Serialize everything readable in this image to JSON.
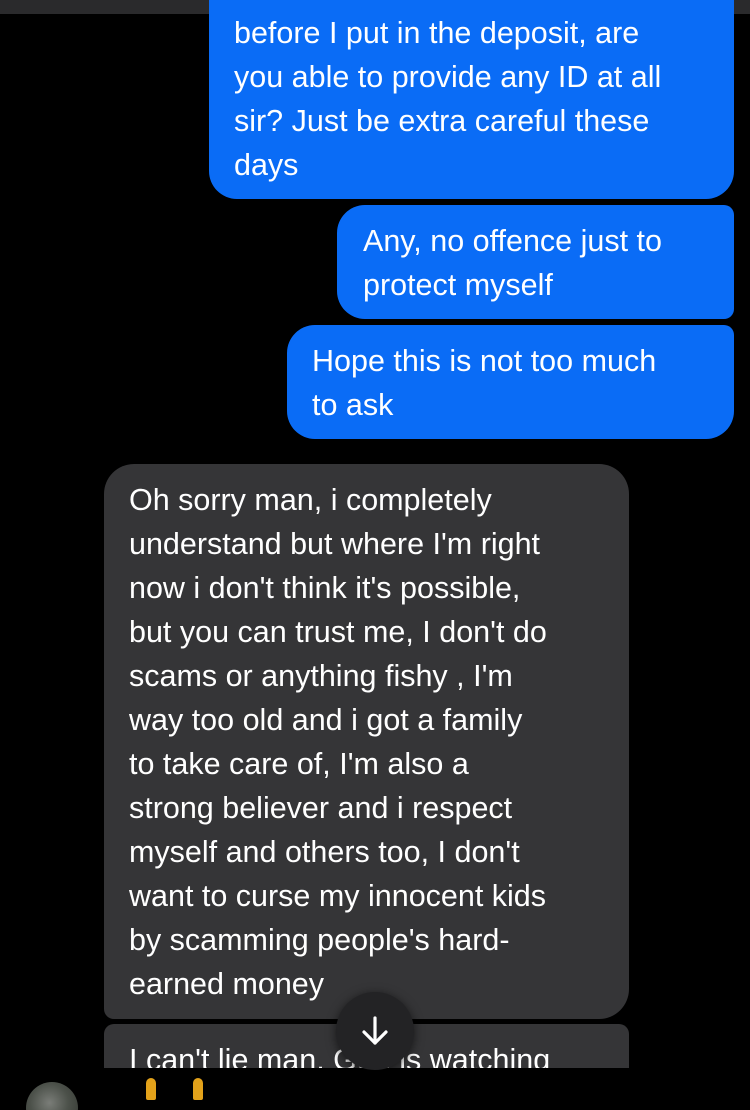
{
  "messages": [
    {
      "id": "m1",
      "direction": "outgoing",
      "text": "before I put in the deposit, are\nyou able to provide any ID at all\nsir?  Just be extra careful these\ndays"
    },
    {
      "id": "m2",
      "direction": "outgoing",
      "text": "Any, no offence just to\nprotect myself"
    },
    {
      "id": "m3",
      "direction": "outgoing",
      "text": "Hope this is not too much\nto ask"
    },
    {
      "id": "m4",
      "direction": "incoming",
      "text": "Oh sorry man, i completely\nunderstand but where I'm right\nnow i don't think it's possible,\nbut you can trust me, I don't do\nscams or anything fishy , I'm\nway too old and i got a family\nto take care of, I'm also a\nstrong believer and i respect\nmyself and others too, I don't\nwant to curse my innocent kids\nby scamming people's hard-\nearned money"
    },
    {
      "id": "m5",
      "direction": "incoming",
      "text": "I can't lie man, God is watching"
    }
  ],
  "colors": {
    "background": "#000000",
    "outgoing_bubble": "#0a6cf6",
    "incoming_bubble": "#353537",
    "text": "#ffffff",
    "scroll_button": "#232325"
  },
  "icons": {
    "scroll_down": "arrow-down-icon",
    "sender_avatar": "avatar"
  }
}
